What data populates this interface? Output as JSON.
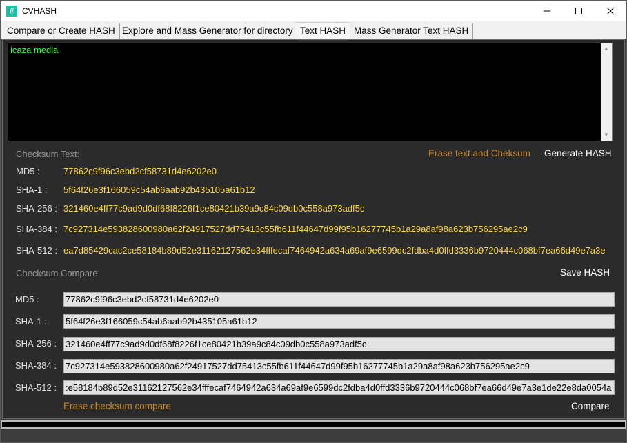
{
  "window": {
    "title": "CVHASH",
    "icon_glyph": "#",
    "controls": {
      "minimize": "—",
      "maximize": "☐",
      "close": "✕"
    }
  },
  "tabs": [
    {
      "label": "Compare or Create HASH"
    },
    {
      "label": "Explore and Mass Generator for directory"
    },
    {
      "label": "Text HASH",
      "active": true
    },
    {
      "label": "Mass Generator Text HASH"
    }
  ],
  "text_input": {
    "value": "icaza media"
  },
  "checksum_text": {
    "section_label": "Checksum Text:",
    "erase_label": "Erase text and Cheksum",
    "generate_label": "Generate HASH",
    "rows": [
      {
        "label": "MD5 :",
        "value": "77862c9f96c3ebd2cf58731d4e6202e0"
      },
      {
        "label": "SHA-1 :",
        "value": "5f64f26e3f166059c54ab6aab92b435105a61b12"
      },
      {
        "label": "SHA-256 :",
        "value": "321460e4ff77c9ad9d0df68f8226f1ce80421b39a9c84c09db0c558a973adf5c"
      },
      {
        "label": "SHA-384 :",
        "value": "7c927314e593828600980a62f24917527dd75413c55fb611f44647d99f95b16277745b1a29a8af98a623b756295ae2c9"
      },
      {
        "label": "SHA-512 :",
        "value": "ea7d85429cac2ce58184b89d52e31162127562e34fffecaf7464942a634a69af9e6599dc2fdba4d0ffd3336b9720444c068bf7ea66d49e7a3e"
      }
    ]
  },
  "checksum_compare": {
    "section_label": "Checksum Compare:",
    "save_label": "Save HASH",
    "erase_label": "Erase checksum compare",
    "compare_label": "Compare",
    "rows": [
      {
        "label": "MD5 :",
        "value": "77862c9f96c3ebd2cf58731d4e6202e0"
      },
      {
        "label": "SHA-1 :",
        "value": "5f64f26e3f166059c54ab6aab92b435105a61b12"
      },
      {
        "label": "SHA-256 :",
        "value": "321460e4ff77c9ad9d0df68f8226f1ce80421b39a9c84c09db0c558a973adf5c"
      },
      {
        "label": "SHA-384 :",
        "value": "7c927314e593828600980a62f24917527dd75413c55fb611f44647d99f95b16277745b1a29a8af98a623b756295ae2c9"
      },
      {
        "label": "SHA-512 :",
        "value": ":e58184b89d52e31162127562e34fffecaf7464942a634a69af9e6599dc2fdba4d0ffd3336b9720444c068bf7ea66d49e7a3e1de22e8da0054a"
      }
    ]
  },
  "colors": {
    "hash_text": "#ffd84a",
    "input_text": "#2dff3a",
    "link": "#c8882a"
  }
}
